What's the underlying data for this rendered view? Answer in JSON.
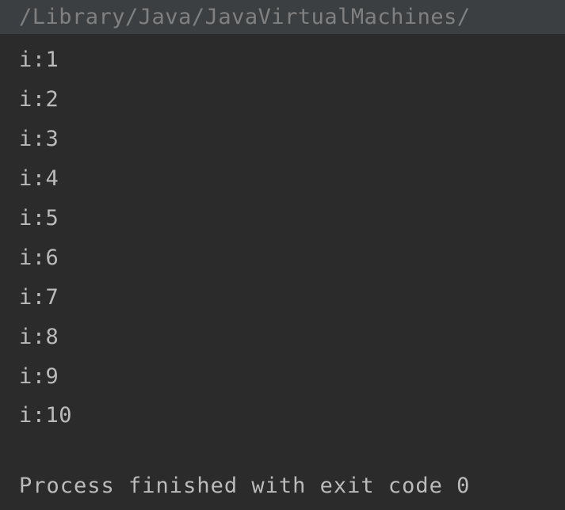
{
  "console": {
    "command": "/Library/Java/JavaVirtualMachines/",
    "output": [
      "i:1",
      "i:2",
      "i:3",
      "i:4",
      "i:5",
      "i:6",
      "i:7",
      "i:8",
      "i:9",
      "i:10"
    ],
    "exit_message": "Process finished with exit code 0"
  }
}
